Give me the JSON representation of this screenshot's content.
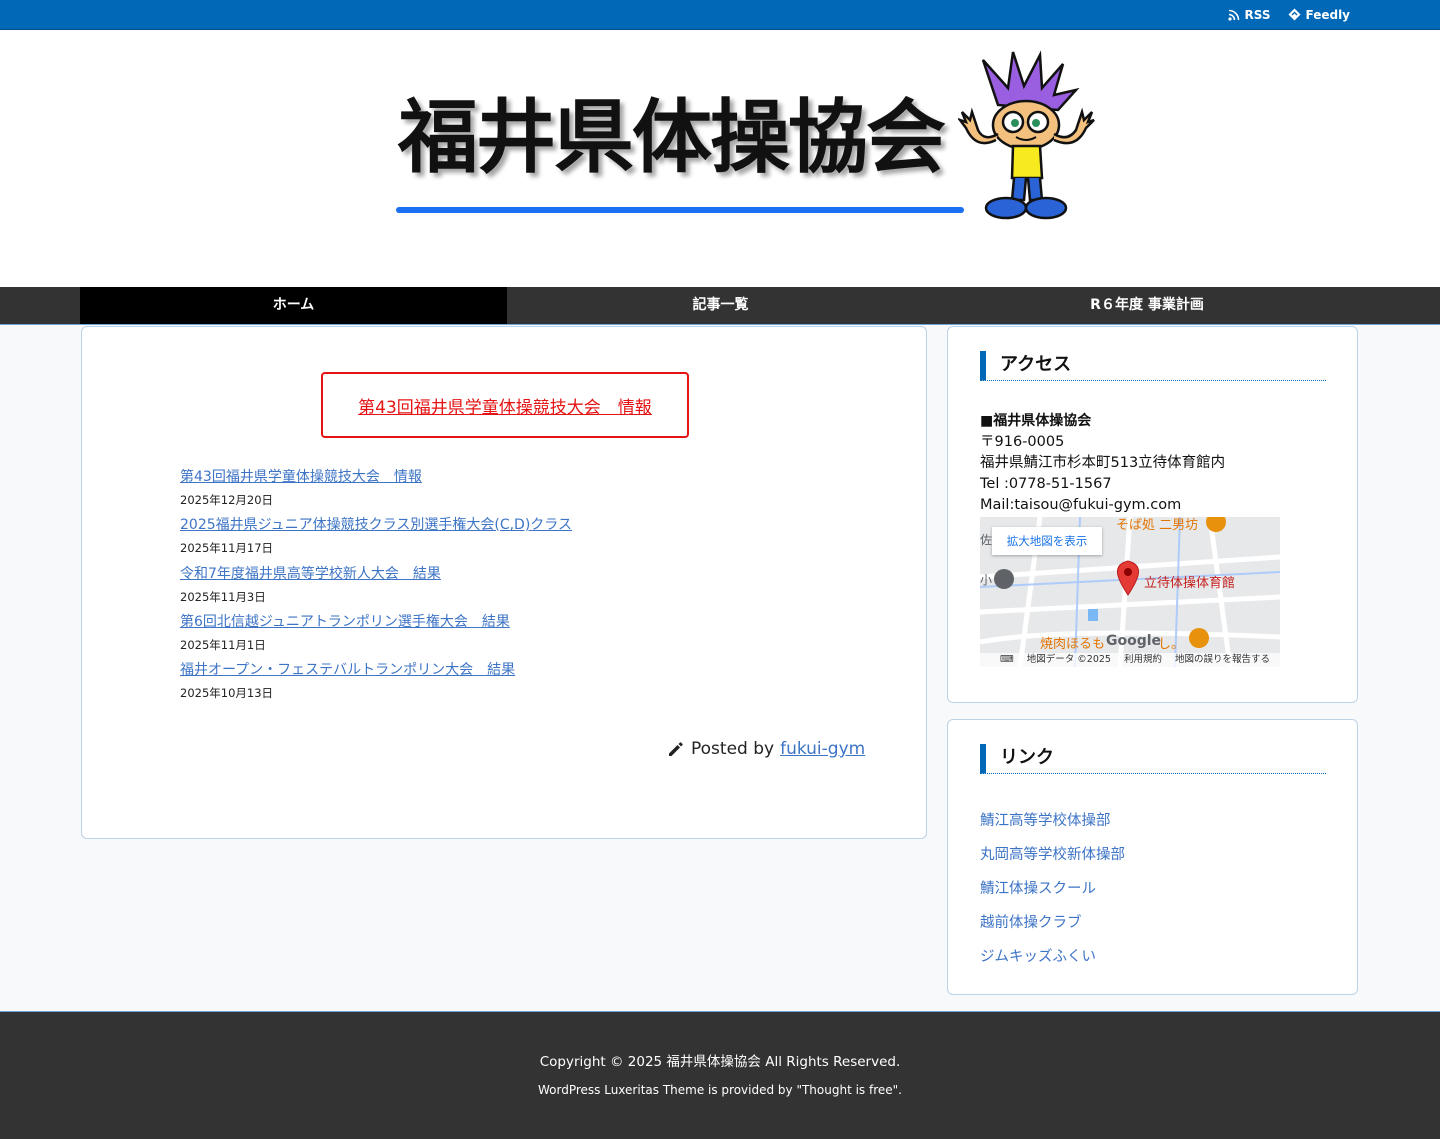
{
  "topbar": {
    "rss_label": "RSS",
    "feedly_label": "Feedly",
    "color": "#0068b7"
  },
  "header": {
    "site_title": "福井県体操協会"
  },
  "nav": {
    "items": [
      {
        "label": "ホーム"
      },
      {
        "label": "記事一覧"
      },
      {
        "label": "R６年度 事業計画"
      }
    ]
  },
  "main": {
    "highlight_link": "第43回福井県学童体操競技大会　情報",
    "posts": [
      {
        "title": "第43回福井県学童体操競技大会　情報",
        "date": "2025年12月20日"
      },
      {
        "title": "2025福井県ジュニア体操競技クラス別選手権大会(C,D)クラス",
        "date": "2025年11月17日"
      },
      {
        "title": "令和7年度福井県高等学校新人大会　結果",
        "date": "2025年11月3日"
      },
      {
        "title": "第6回北信越ジュニアトランポリン選手権大会　結果",
        "date": "2025年11月1日"
      },
      {
        "title": "福井オープン・フェステバルトランポリン大会　結果",
        "date": "2025年10月13日"
      }
    ],
    "posted_by_prefix": "Posted by",
    "posted_by_author": "fukui-gym"
  },
  "sidebar": {
    "access": {
      "title": "アクセス",
      "org": "■福井県体操協会",
      "postal": "〒916-0005",
      "address": "福井県鯖江市杉本町513立待体育館内",
      "tel": "Tel :0778-51-1567",
      "mail": "Mail:taisou@fukui-gym.com",
      "map": {
        "enlarge_label": "拡大地図を表示",
        "marker_label": "立待体操体育館",
        "poi_1": "そば処 二男坊",
        "poi_2": "焼肉ほるも",
        "poi_3": "し。",
        "google_label": "Google",
        "edge_text_1": "佐",
        "edge_text_2": "小",
        "keyboard_icon": "keyboard-icon",
        "map_data": "地図データ ©2025",
        "terms": "利用規約",
        "report": "地図の誤りを報告する"
      }
    },
    "links": {
      "title": "リンク",
      "items": [
        {
          "label": "鯖江高等学校体操部"
        },
        {
          "label": "丸岡高等学校新体操部"
        },
        {
          "label": "鯖江体操スクール"
        },
        {
          "label": "越前体操クラブ"
        },
        {
          "label": "ジムキッズふくい"
        }
      ]
    }
  },
  "footer": {
    "copyright": "Copyright © 2025 福井県体操協会 All Rights Reserved.",
    "theme_credit": "WordPress Luxeritas Theme is provided by \"Thought is free\"."
  }
}
